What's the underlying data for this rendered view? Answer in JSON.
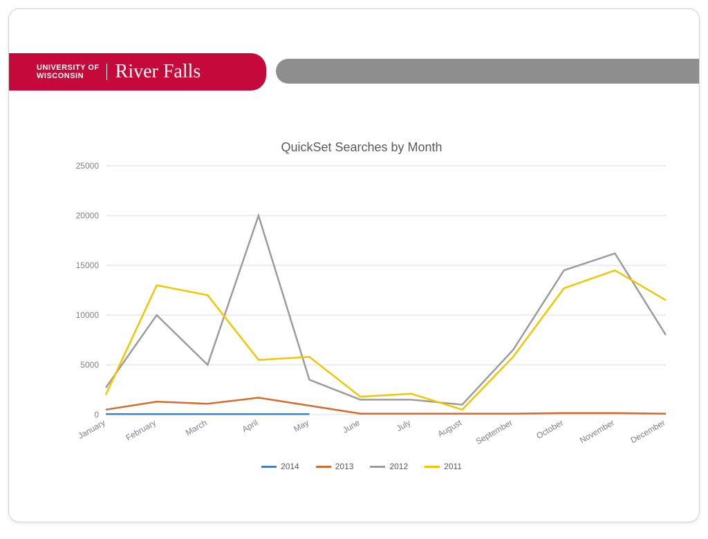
{
  "brand": {
    "university_line1": "UNIVERSITY OF",
    "university_line2": "WISCONSIN",
    "campus": "River Falls"
  },
  "chart_data": {
    "type": "line",
    "title": "QuickSet Searches by Month",
    "xlabel": "",
    "ylabel": "",
    "ylim": [
      0,
      25000
    ],
    "yticks": [
      0,
      5000,
      10000,
      15000,
      20000,
      25000
    ],
    "categories": [
      "January",
      "February",
      "March",
      "April",
      "May",
      "June",
      "July",
      "August",
      "September",
      "October",
      "November",
      "December"
    ],
    "series": [
      {
        "name": "2014",
        "color": "#4a7ebb",
        "values": [
          50,
          50,
          50,
          50,
          50,
          null,
          null,
          null,
          null,
          null,
          null,
          null
        ]
      },
      {
        "name": "2013",
        "color": "#d66a2d",
        "values": [
          500,
          1300,
          1100,
          1700,
          900,
          100,
          100,
          100,
          100,
          150,
          150,
          100
        ]
      },
      {
        "name": "2012",
        "color": "#9b9b9b",
        "values": [
          2700,
          10000,
          5000,
          20000,
          3500,
          1500,
          1500,
          1000,
          6500,
          14500,
          16200,
          8000
        ]
      },
      {
        "name": "2011",
        "color": "#f2c500",
        "values": [
          2000,
          13000,
          12000,
          5500,
          5800,
          1800,
          2100,
          500,
          5800,
          12700,
          14500,
          11500
        ]
      }
    ],
    "legend_position": "bottom"
  }
}
